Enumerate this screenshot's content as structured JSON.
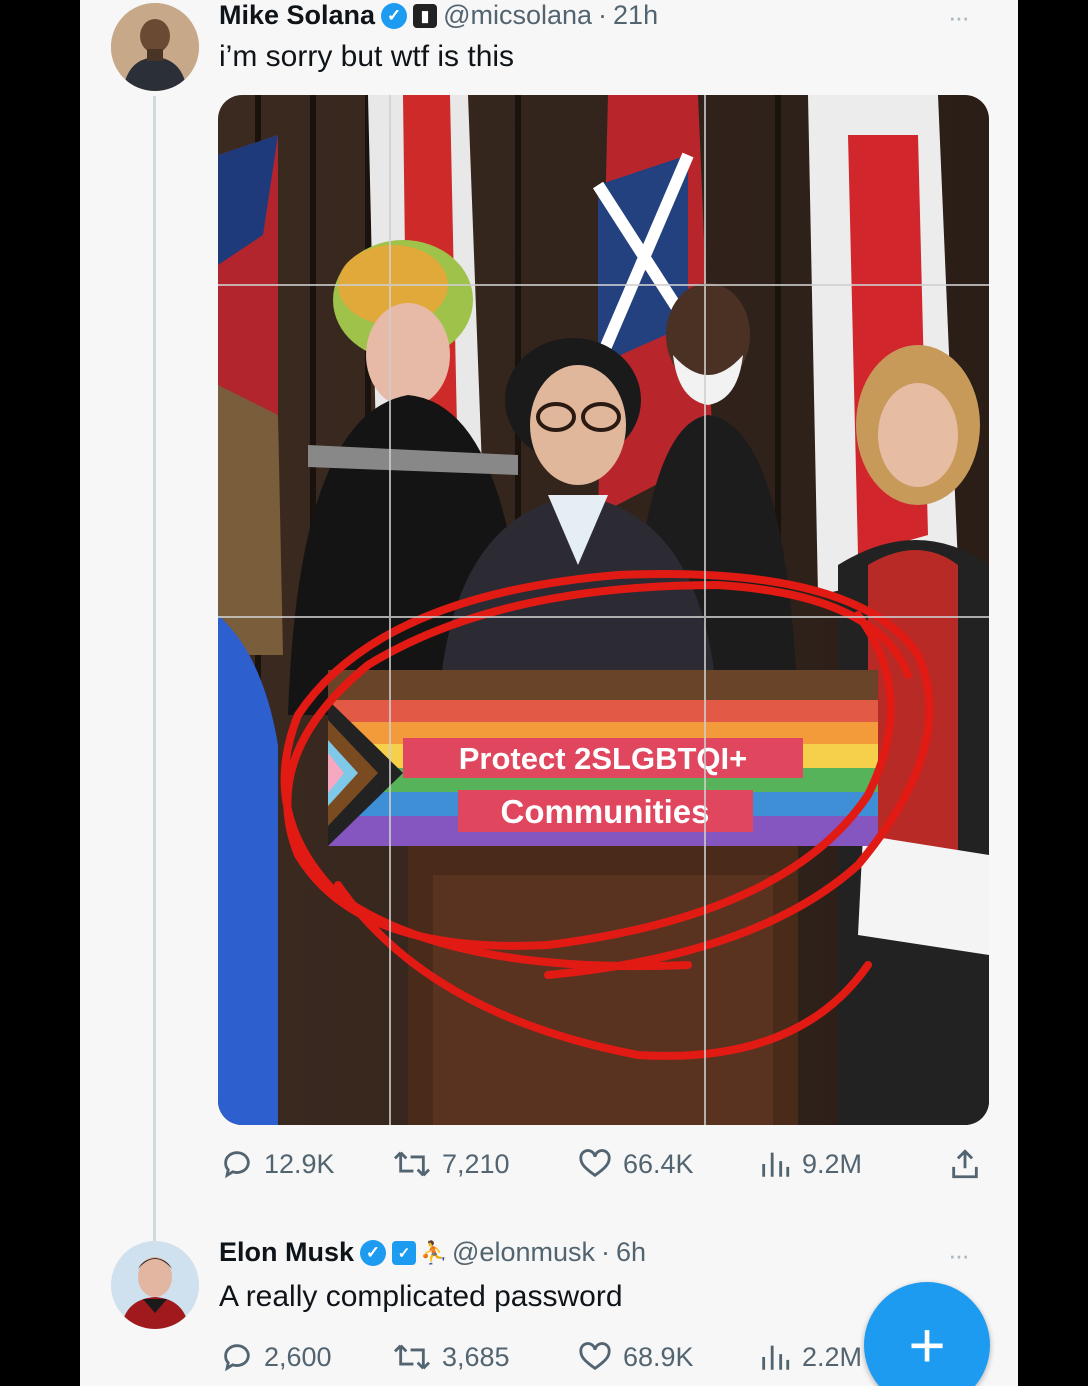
{
  "tweet1": {
    "name": "Mike Solana",
    "handle": "@micsolana",
    "time": "21h",
    "text": "i’m sorry but wtf is this",
    "podium_line1": "Protect 2SLGBTQI+",
    "podium_line2": "Communities",
    "stats": {
      "replies": "12.9K",
      "retweets": "7,210",
      "likes": "66.4K",
      "views": "9.2M"
    }
  },
  "tweet2": {
    "name": "Elon Musk",
    "handle": "@elonmusk",
    "time": "6h",
    "text": "A really complicated password",
    "stats": {
      "replies": "2,600",
      "retweets": "3,685",
      "likes": "68.9K",
      "views": "2.2M"
    }
  },
  "separator": "·",
  "more_label": "···",
  "fab_label": "+",
  "colors": {
    "accent": "#1d9bf0",
    "text": "#0f1419",
    "muted": "#536471",
    "circle": "#e11a14"
  }
}
